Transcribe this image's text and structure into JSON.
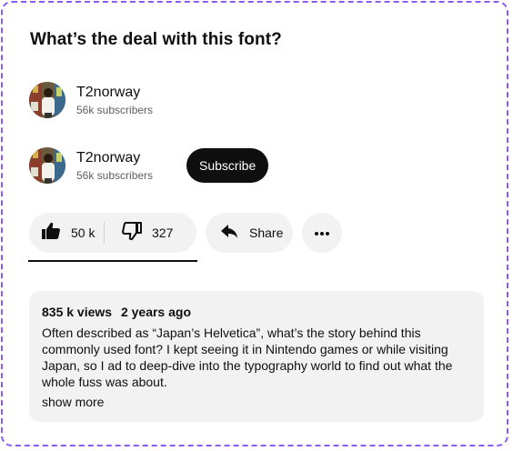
{
  "video": {
    "title": "What’s the deal with this font?"
  },
  "channels": [
    {
      "name": "T2norway",
      "subscribers": "56k subscribers"
    },
    {
      "name": "T2norway",
      "subscribers": "56k subscribers",
      "subscribe_label": "Subscribe"
    }
  ],
  "actions": {
    "like_count": "50 k",
    "dislike_count": "327",
    "share_label": "Share"
  },
  "description": {
    "views": "835 k views",
    "age": "2 years ago",
    "text": "Often described as “Japan’s Helvetica”, what’s the story behind this commonly used font? I kept seeing it in Nintendo games or while visiting Japan, so I ad to deep-dive into the typography world to find out what the whole fuss was about.",
    "show_more_label": "show more"
  },
  "icons": {
    "like": "thumbs-up-icon",
    "dislike": "thumbs-down-icon",
    "share": "share-arrow-icon",
    "more": "more-dots-icon"
  },
  "colors": {
    "frame_border": "#8a5cf5",
    "subscribe_bg": "#0f0f0f",
    "pill_bg": "#f2f2f2"
  }
}
